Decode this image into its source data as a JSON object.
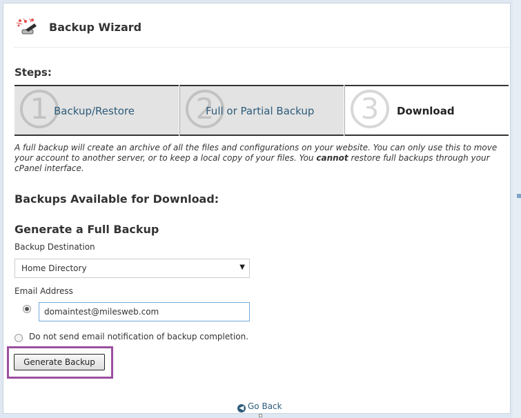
{
  "header": {
    "title": "Backup Wizard"
  },
  "steps": {
    "heading": "Steps:",
    "items": [
      {
        "number": "1",
        "label": "Backup/Restore",
        "state": "inactive"
      },
      {
        "number": "2",
        "label": "Full or Partial Backup",
        "state": "inactive"
      },
      {
        "number": "3",
        "label": "Download",
        "state": "active"
      }
    ]
  },
  "description": {
    "before": "A full backup will create an archive of all the files and configurations on your website. You can only use this to move your account to another server, or to keep a local copy of your files. You ",
    "emphasis": "cannot",
    "after": " restore full backups through your cPanel interface."
  },
  "downloads": {
    "heading": "Backups Available for Download:"
  },
  "generate": {
    "heading": "Generate a Full Backup",
    "destination_label": "Backup Destination",
    "destination_value": "Home Directory",
    "email_label": "Email Address",
    "email_value": "domaintest@milesweb.com",
    "no_email_label": "Do not send email notification of backup completion.",
    "button_label": "Generate Backup"
  },
  "footer": {
    "go_back": "Go Back"
  },
  "colors": {
    "link": "#2d5b7a",
    "highlight": "#9b4f9f",
    "input_focus": "#74a9d8"
  },
  "icons": {
    "wizard": "wizard-wand-icon",
    "select_caret": "caret-down-icon",
    "go_back": "arrow-left-circle-icon"
  }
}
